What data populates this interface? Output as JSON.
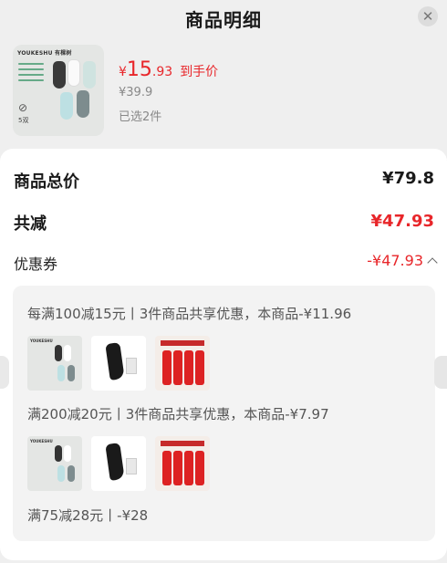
{
  "header": {
    "title": "商品明细",
    "close_icon": "close-icon"
  },
  "product": {
    "thumb_brand": "YOUKESHU 有棵树",
    "thumb_count": "5双",
    "price_yen": "¥",
    "price_int": "15",
    "price_dec": ".93",
    "price_tag": "到手价",
    "original_price": "¥39.9",
    "selected": "已选2件"
  },
  "summary": {
    "total_label": "商品总价",
    "total_value": "¥79.8",
    "reduce_label": "共减",
    "reduce_value": "¥47.93",
    "coupon_label": "优惠券",
    "coupon_value": "-¥47.93"
  },
  "coupons": [
    {
      "rule": "每满100减15元丨3件商品共享优惠，本商品-¥11.96"
    },
    {
      "rule": "满200减20元丨3件商品共享优惠，本商品-¥7.97"
    },
    {
      "rule": "满75减28元丨-¥28"
    }
  ],
  "colors": {
    "accent": "#e8262a",
    "muted": "#888888",
    "panel": "#f3f3f3"
  }
}
